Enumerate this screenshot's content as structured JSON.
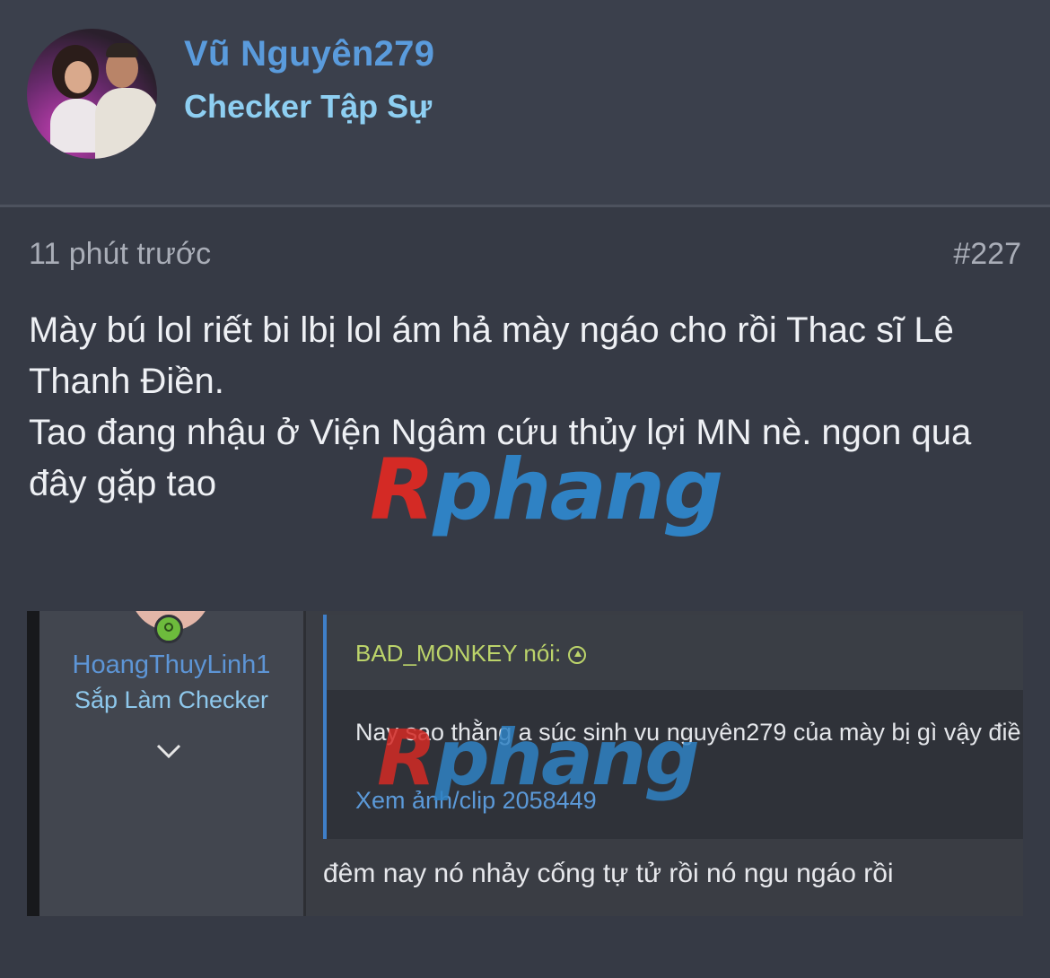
{
  "header": {
    "username": "Vũ Nguyên279",
    "user_title": "Checker Tập Sự"
  },
  "post": {
    "time": "11 phút trước",
    "number": "#227",
    "lines": [
      "Mày bú lol riết bi lbị lol ám hả mày ngáo cho rồi Thac sĩ Lê Thanh Điền.",
      "Tao đang nhậu ở Viện Ngâm cứu thủy lợi MN nè. ngon qua đây gặp tao"
    ]
  },
  "watermark": {
    "first_letter": "R",
    "rest": "phang"
  },
  "embedded": {
    "username": "HoangThuyLinh1",
    "user_title": "Sắp Làm Checker",
    "quote_author": "BAD_MONKEY nói:",
    "quote_text": "Nay sao thằng a súc sinh vu nguyên279 của mày bị gì vậy điề",
    "quote_link": "Xem ảnh/clip 2058449",
    "reply_text": "đêm nay nó nhảy cống tự tử rồi nó ngu ngáo rồi"
  },
  "icons": [
    "avatar",
    "online-status-icon",
    "chevron-down-icon",
    "arrow-up-circle-icon"
  ]
}
